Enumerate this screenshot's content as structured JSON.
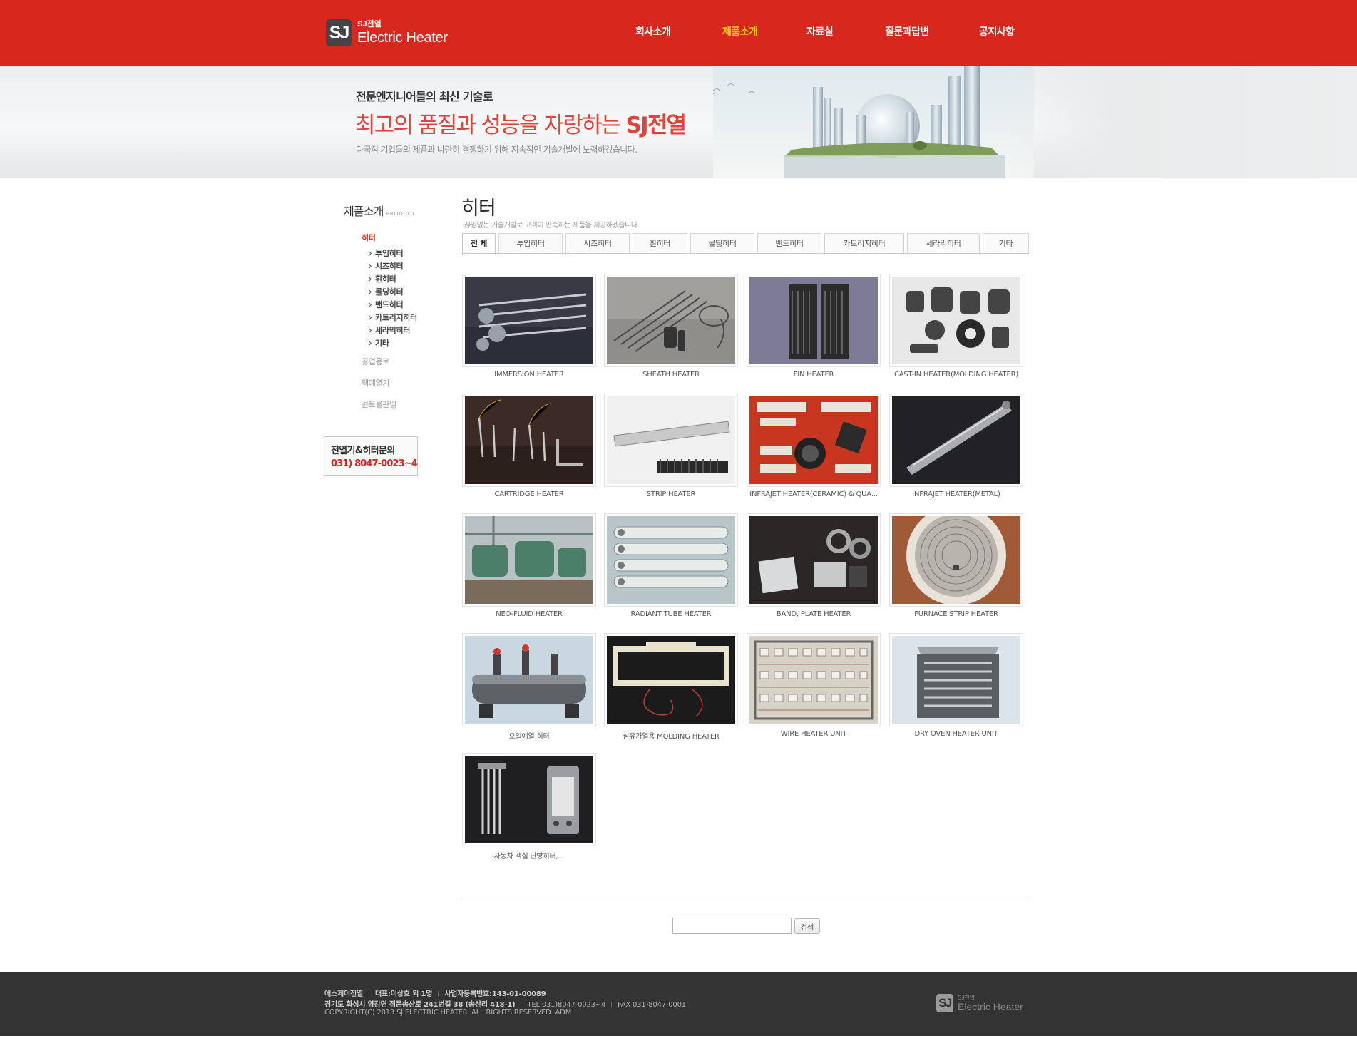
{
  "header": {
    "logo_small": "SJ전열",
    "logo_big": "Electric Heater",
    "logo_badge": "SJ",
    "nav": [
      {
        "label": "회사소개",
        "active": false
      },
      {
        "label": "제품소개",
        "active": true
      },
      {
        "label": "자료실",
        "active": false
      },
      {
        "label": "질문과답변",
        "active": false
      },
      {
        "label": "공지사항",
        "active": false
      }
    ]
  },
  "banner": {
    "line1": "전문엔지니어들의 최신 기술로",
    "line2_a": "최고의 품질과 성능을 자랑하는 ",
    "line2_b": "SJ전열",
    "line3": "다국적 기업들의 제품과 나란히 경쟁하기 위해 지속적인 기술개발에 노력하겠습니다."
  },
  "sidebar": {
    "title": "제품소개",
    "title_sub": "PRODUCT",
    "active_category": "히터",
    "sub_items": [
      "투입히터",
      "시즈히터",
      "휜히터",
      "몰딩히터",
      "밴드히터",
      "카트리지히터",
      "세라믹히터",
      "기타"
    ],
    "other_categories": [
      "공업용로",
      "팩예열기",
      "콘트롤판넬"
    ],
    "inquiry_title": "전열기&히터문의",
    "inquiry_phone": "031) 8047-0023~4"
  },
  "content": {
    "title": "히터",
    "description": "끊임없는 기술개발로 고객이 만족하는 제품을 제공하겠습니다.",
    "tabs": [
      "전 체",
      "투입히터",
      "시즈히터",
      "휜히터",
      "몰딩히터",
      "밴드히터",
      "카트리지히터",
      "세라믹히터",
      "기타"
    ],
    "active_tab": 0,
    "products": [
      "IMMERSION HEATER",
      "SHEATH HEATER",
      "FIN HEATER",
      "CAST-IN HEATER(MOLDING HEATER)",
      "CARTRIDGE HEATER",
      "STRIP HEATER",
      "INFRAJET HEATER(CERAMIC) & QUA...",
      "INFRAJET HEATER(METAL)",
      "NEO-FLUID HEATER",
      "RADIANT TUBE HEATER",
      "BAND, PLATE HEATER",
      "FURNACE STRIP HEATER",
      "오일예열 히터",
      "섬유가열용 MOLDING HEATER",
      "WIRE HEATER UNIT",
      "DRY OVEN HEATER UNIT",
      "자동차 객실 난방히터,..."
    ],
    "search_value": "",
    "search_button": "검색"
  },
  "footer": {
    "company": "에스제이전열",
    "ceo": "대표:이상호 외 1명",
    "biz_no": "사업자등록번호:143-01-00089",
    "address": "경기도 화성시 양감면 정문송산로 241번길 38 (송산리 418-1)",
    "tel": "TEL 031)8047-0023~4",
    "fax": "FAX 031)8047-0001",
    "copyright": "COPYRIGHT(C) 2013 SJ ELECTRIC HEATER. ALL RIGHTS RESERVED. ADM",
    "logo_small": "SJ전열",
    "logo_big": "Electric Heater",
    "logo_badge": "SJ"
  },
  "colors": {
    "brand_red": "#d8281d",
    "nav_active": "#ffd200",
    "footer_bg": "#333333"
  }
}
